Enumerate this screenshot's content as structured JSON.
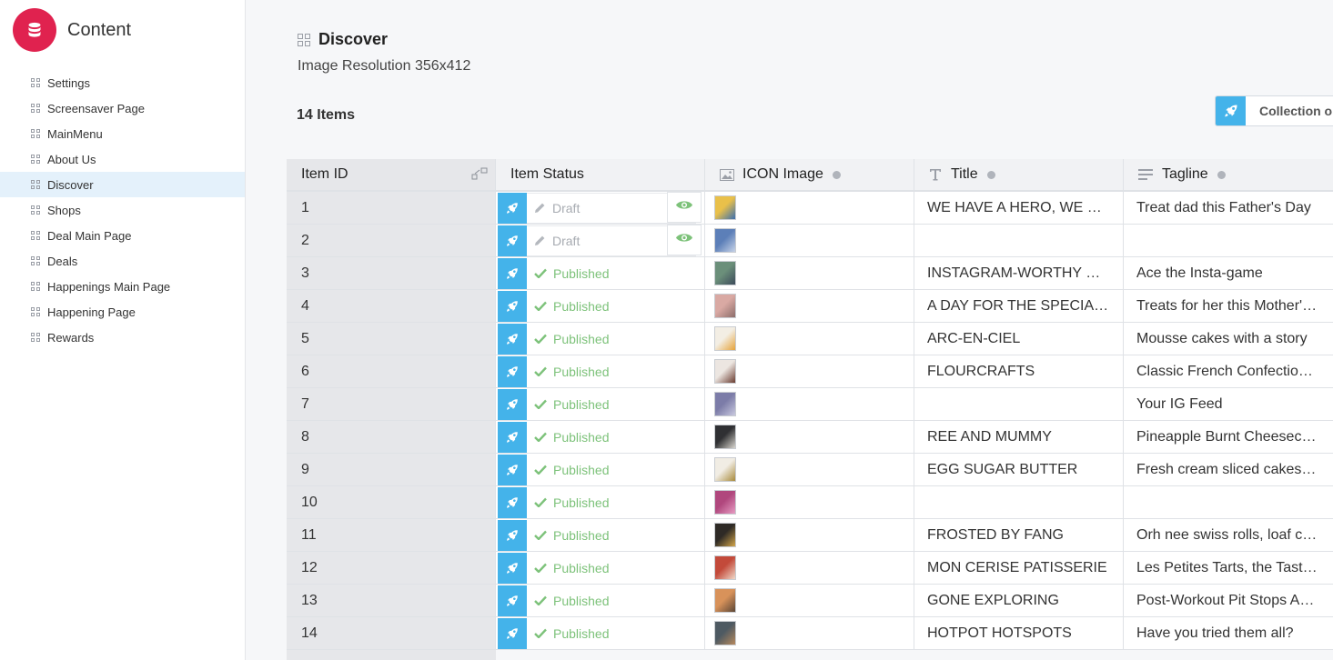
{
  "app": {
    "title": "Content"
  },
  "sidebar": {
    "items": [
      {
        "label": "Settings",
        "active": false
      },
      {
        "label": "Screensaver Page",
        "active": false
      },
      {
        "label": "MainMenu",
        "active": false
      },
      {
        "label": "About Us",
        "active": false
      },
      {
        "label": "Discover",
        "active": true
      },
      {
        "label": "Shops",
        "active": false
      },
      {
        "label": "Deal Main Page",
        "active": false
      },
      {
        "label": "Deals",
        "active": false
      },
      {
        "label": "Happenings Main Page",
        "active": false
      },
      {
        "label": "Happening Page",
        "active": false
      },
      {
        "label": "Rewards",
        "active": false
      }
    ]
  },
  "page": {
    "title": "Discover",
    "subtitle": "Image Resolution 356x412",
    "item_count": "14 Items",
    "collection_button": "Collection op"
  },
  "table": {
    "columns": [
      "Item ID",
      "Item Status",
      "ICON Image",
      "Title",
      "Tagline"
    ],
    "rows": [
      {
        "id": "1",
        "status": "Draft",
        "title": "WE HAVE A HERO, WE CAN'T WAIT",
        "tagline": "Treat dad this Father's Day",
        "thumb": [
          "#e9c04a",
          "#3b6fb0"
        ]
      },
      {
        "id": "2",
        "status": "Draft",
        "title": "",
        "tagline": "",
        "thumb": [
          "#5c7fb8",
          "#c7d3e8"
        ]
      },
      {
        "id": "3",
        "status": "Published",
        "title": "INSTAGRAM-WORTHY SPOTS",
        "tagline": "Ace the Insta-game",
        "thumb": [
          "#6b8f7a",
          "#3c4b5a"
        ]
      },
      {
        "id": "4",
        "status": "Published",
        "title": "A DAY FOR THE SPECIAL WOMAN",
        "tagline": "Treats for her this Mother's Day",
        "thumb": [
          "#d9a9a3",
          "#8c6d6a"
        ]
      },
      {
        "id": "5",
        "status": "Published",
        "title": "ARC-EN-CIEL",
        "tagline": "Mousse cakes with a story",
        "thumb": [
          "#f3eee4",
          "#e6a33a"
        ]
      },
      {
        "id": "6",
        "status": "Published",
        "title": "FLOURCRAFTS",
        "tagline": "Classic French Confectionery",
        "thumb": [
          "#ece6e1",
          "#6a3b2f"
        ]
      },
      {
        "id": "7",
        "status": "Published",
        "title": "",
        "tagline": "Your IG Feed",
        "thumb": [
          "#7c7ca8",
          "#c9c9df"
        ]
      },
      {
        "id": "8",
        "status": "Published",
        "title": "REE AND MUMMY",
        "tagline": "Pineapple Burnt Cheesecake",
        "thumb": [
          "#2f3033",
          "#d9d6cf"
        ]
      },
      {
        "id": "9",
        "status": "Published",
        "title": "EGG SUGAR BUTTER",
        "tagline": "Fresh cream sliced cakes and more",
        "thumb": [
          "#f1ede4",
          "#a88a3b"
        ]
      },
      {
        "id": "10",
        "status": "Published",
        "title": "",
        "tagline": "",
        "thumb": [
          "#b0477d",
          "#e79cc3"
        ]
      },
      {
        "id": "11",
        "status": "Published",
        "title": "FROSTED BY FANG",
        "tagline": "Orh nee swiss rolls, loaf cakes",
        "thumb": [
          "#2e2a26",
          "#d4a64a"
        ]
      },
      {
        "id": "12",
        "status": "Published",
        "title": "MON CERISE PATISSERIE",
        "tagline": "Les Petites Tarts, the Tasting Box",
        "thumb": [
          "#c34a3a",
          "#f0d9c9"
        ]
      },
      {
        "id": "13",
        "status": "Published",
        "title": "GONE EXPLORING",
        "tagline": "Post-Workout Pit Stops Around",
        "thumb": [
          "#d8925a",
          "#5b4636"
        ]
      },
      {
        "id": "14",
        "status": "Published",
        "title": "HOTPOT HOTSPOTS",
        "tagline": "Have you tried them all?",
        "thumb": [
          "#4e5a62",
          "#b78a5e"
        ]
      }
    ]
  },
  "colors": {
    "brand": "#e0224f",
    "accent_blue": "#44b3ea",
    "published_green": "#7dc27a",
    "draft_grey": "#a7abb1",
    "active_nav": "#e4f1fb"
  },
  "icons": {
    "brand": "database-icon",
    "nav": "grid-icon",
    "rocket": "rocket-icon",
    "preview": "eye-icon",
    "draft": "pencil-icon",
    "published": "check-icon"
  }
}
